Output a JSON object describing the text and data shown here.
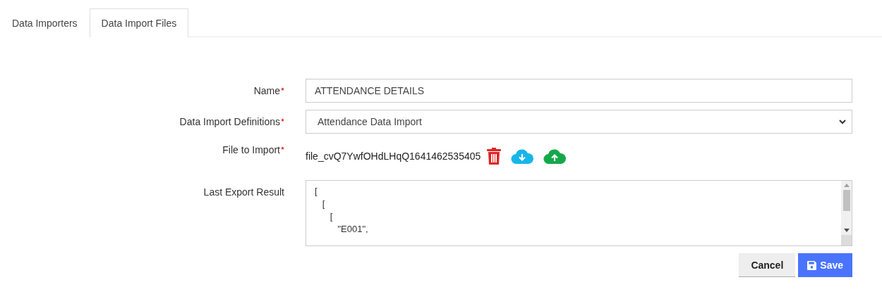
{
  "tabs": [
    {
      "label": "Data Importers",
      "selected": false
    },
    {
      "label": "Data Import Files",
      "selected": true
    }
  ],
  "form": {
    "fields": [
      {
        "kind": "text",
        "label": "Name",
        "required": true,
        "value": "ATTENDANCE DETAILS"
      },
      {
        "kind": "select",
        "label": "Data Import Definitions",
        "required": true,
        "value": "Attendance Data Import"
      },
      {
        "kind": "file",
        "label": "File to Import",
        "required": true,
        "value": "file_cvQ7YwfOHdLHqQ1641462535405"
      },
      {
        "kind": "textarea",
        "label": "Last Export Result",
        "required": false,
        "lines": [
          "[",
          "   [",
          "      [",
          "         \"E001\","
        ]
      }
    ]
  },
  "buttons": [
    {
      "label": "Cancel",
      "kind": "secondary"
    },
    {
      "label": "Save",
      "kind": "primary"
    }
  ]
}
